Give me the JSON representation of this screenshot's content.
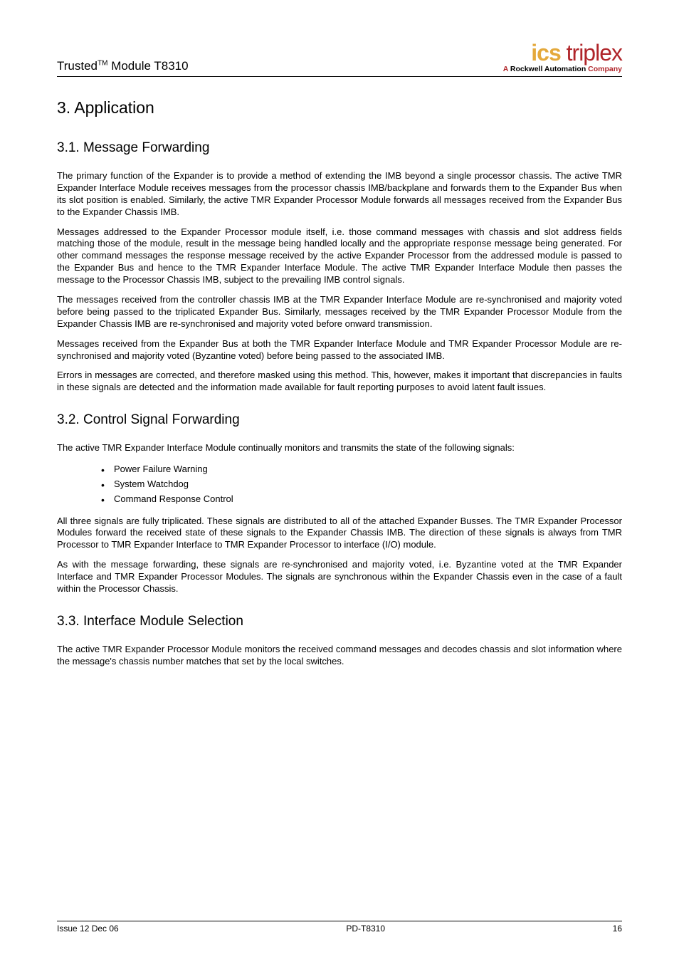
{
  "header": {
    "left_prefix": "Trusted",
    "left_tm": "TM",
    "left_suffix": " Module T8310",
    "logo_ics": "ics",
    "logo_triplex": " triplex",
    "logo_sub_prefix": "A ",
    "logo_sub_rockwell": "Rockwell Automation",
    "logo_sub_suffix": " Company"
  },
  "h1": "3.    Application",
  "sections": [
    {
      "heading": "3.1. Message Forwarding",
      "paragraphs": [
        "The primary function of the Expander is to provide a method of extending the IMB beyond a single processor chassis.  The active TMR Expander Interface Module receives messages from the processor chassis IMB/backplane and forwards them to the Expander Bus when its slot position is enabled.  Similarly, the active TMR Expander Processor Module forwards all messages received from the Expander Bus to the Expander Chassis IMB.",
        "Messages addressed to the Expander Processor module itself, i.e. those command messages with chassis and slot address fields matching those of the module, result in the message being handled locally and the appropriate response message being generated.  For other command messages the response message received by the active Expander Processor from the addressed module is passed to the Expander Bus and hence to the TMR Expander Interface Module.  The active TMR Expander Interface Module then passes the message to the Processor Chassis IMB, subject to the prevailing IMB control signals.",
        "The messages received from the controller chassis IMB at the TMR Expander Interface Module are re-synchronised and majority voted before being passed to the triplicated Expander Bus.  Similarly, messages received by the TMR Expander Processor Module from the Expander Chassis IMB are re-synchronised and majority voted before onward transmission.",
        "Messages received from the Expander Bus at both the TMR Expander Interface Module and TMR Expander Processor Module are re-synchronised and majority voted (Byzantine voted) before being passed to the associated IMB.",
        "Errors in messages are corrected, and therefore masked using this method.  This, however, makes it important that discrepancies in faults in these signals are detected and the information made available for fault reporting purposes to avoid latent fault issues."
      ]
    },
    {
      "heading": "3.2. Control Signal Forwarding",
      "paragraphs_before": [
        "The active TMR Expander Interface Module continually monitors and transmits the state of the following signals:"
      ],
      "bullets": [
        "Power Failure Warning",
        "System Watchdog",
        "Command Response Control"
      ],
      "paragraphs_after": [
        "All three signals are fully triplicated.  These signals are distributed to all of the attached Expander Busses.  The TMR Expander Processor Modules forward the received state of these signals to the Expander Chassis IMB. The direction of these signals is always from TMR Processor to TMR Expander Interface to TMR Expander Processor to interface (I/O) module.",
        "As with the message forwarding, these signals are re-synchronised and majority voted, i.e. Byzantine voted at the TMR Expander Interface and TMR Expander Processor Modules.  The signals are synchronous within the Expander Chassis even in the case of a fault within the Processor Chassis."
      ]
    },
    {
      "heading": "3.3. Interface Module Selection",
      "paragraphs": [
        "The active TMR Expander Processor Module monitors the received command messages and decodes chassis and slot information where the message's chassis number matches that set by the local switches."
      ]
    }
  ],
  "footer": {
    "left": "Issue 12 Dec 06",
    "center": "PD-T8310",
    "right": "16"
  }
}
